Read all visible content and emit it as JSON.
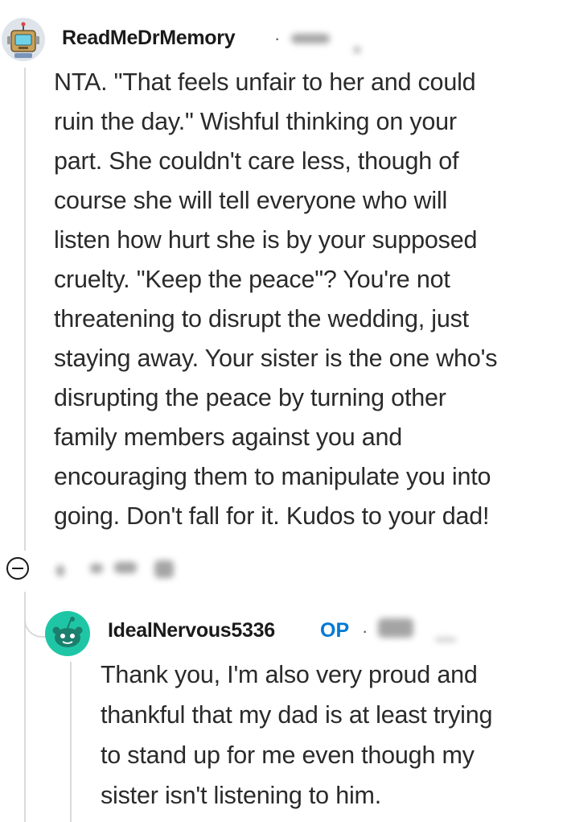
{
  "comment": {
    "author": "ReadMeDrMemory",
    "meta_separator": "·",
    "body_lines": [
      "NTA. \"That feels unfair to her and could",
      "ruin the day.\" Wishful thinking on your",
      "part. She couldn't care less, though of",
      "course she will tell everyone who will",
      "listen how hurt she is by your supposed",
      "cruelty. \"Keep the peace\"? You're not",
      "threatening to disrupt the wedding, just",
      "staying away. Your sister is the one who's",
      "disrupting the peace by turning other",
      "family members against you and",
      "encouraging them to manipulate you into",
      "going. Don't fall for it. Kudos to your dad!"
    ]
  },
  "reply": {
    "author": "IdealNervous5336",
    "op_badge": "OP",
    "meta_separator": "·",
    "body_lines": [
      "Thank you, I'm also very proud and",
      "thankful that my dad is at least trying",
      "to stand up for me even though my",
      "sister isn't listening to him."
    ]
  },
  "icons": {
    "collapse": "minus-circle-icon",
    "main_avatar": "robot-avatar-icon",
    "reply_avatar": "snoo-avatar-icon"
  },
  "colors": {
    "op_badge": "#0079d3",
    "reply_avatar_bg": "#1fc6a6",
    "thread_line": "#dadada"
  }
}
